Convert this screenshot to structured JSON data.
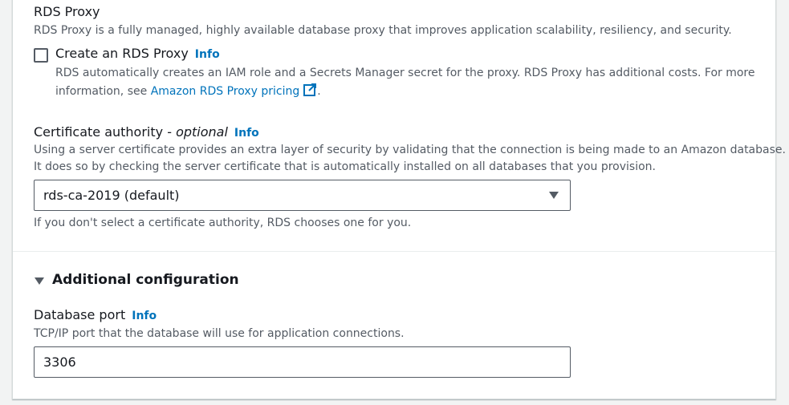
{
  "rds_proxy": {
    "title": "RDS Proxy",
    "description": "RDS Proxy is a fully managed, highly available database proxy that improves application scalability, resiliency, and security.",
    "checkbox_label": "Create an RDS Proxy",
    "info": "Info",
    "checked": false,
    "note_line1": "RDS automatically creates an IAM role and a Secrets Manager secret for the proxy. RDS Proxy has additional costs. For more",
    "note_line2_prefix": "information, see",
    "pricing_link": "Amazon RDS Proxy pricing",
    "note_suffix": "."
  },
  "certificate": {
    "label": "Certificate authority -",
    "optional": "optional",
    "info": "Info",
    "description_line1": "Using a server certificate provides an extra layer of security by validating that the connection is being made to an Amazon database.",
    "description_line2": "It does so by checking the server certificate that is automatically installed on all databases that you provision.",
    "selected": "rds-ca-2019 (default)",
    "hint": "If you don't select a certificate authority, RDS chooses one for you."
  },
  "additional": {
    "title": "Additional configuration",
    "port_label": "Database port",
    "port_info": "Info",
    "port_description": "TCP/IP port that the database will use for application connections.",
    "port_value": "3306"
  },
  "colors": {
    "link": "#0073bb",
    "text": "#16191f",
    "muted": "#545b64"
  }
}
